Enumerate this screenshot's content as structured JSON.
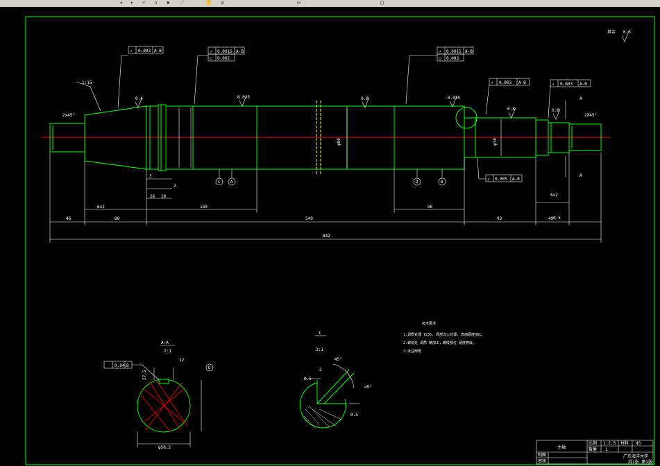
{
  "toolbar": {
    "icons": [
      "undo-icon",
      "redo-icon",
      "cut-icon",
      "copy-icon",
      "paste-icon",
      "match-properties-icon",
      "pan-icon",
      "zoom-icon",
      "zoom-window-icon",
      "zoom-previous-icon"
    ]
  },
  "drawing": {
    "colors": {
      "background": "#000000",
      "outline": "#00ff00",
      "centerline": "#ff0000",
      "dims": "#ffffff",
      "hatch": "#ff0000",
      "keyline": "#ffff00"
    },
    "roughness_label": "其余",
    "roughness_value": "6.3",
    "tol_frames": [
      {
        "sym": "↗",
        "val": "0.003",
        "ref": "A-B"
      },
      {
        "sym": "↗",
        "val": "0.0015",
        "ref": "A-B",
        "sym2": "◯",
        "val2": "0.002"
      },
      {
        "sym": "↗",
        "val": "0.0015",
        "ref": "A-B",
        "sym2": "◯",
        "val2": "0.003"
      },
      {
        "sym": "↗",
        "val": "0.003",
        "ref": "A-B"
      },
      {
        "sym": "↗",
        "val": "0.003",
        "ref": "A-B"
      },
      {
        "sym": "⊥",
        "val": "0.005",
        "ref": "A-B"
      }
    ],
    "surface_finish": [
      "0.4",
      "0.025",
      "0.8",
      "0.025",
      "0.8",
      "0.8"
    ],
    "taper_label": "1:15",
    "chamfers": [
      "2x45°",
      "2X45°"
    ],
    "datum_letters": [
      "C",
      "A",
      "D",
      "B",
      "A",
      "A"
    ],
    "dims": {
      "d46": "46",
      "d6x2": "6x2",
      "d80": "80",
      "d169": "169",
      "d549": "549",
      "d96": "96",
      "d93": "93",
      "d49": "49",
      "d842": "842",
      "d3": "3",
      "d2": "2",
      "d26": "26",
      "d10": "10",
      "d6x2b": "6x2",
      "d05": "0.5",
      "dia_fi80": "φ80",
      "dia_70": "φ70"
    },
    "section_aa_title": "A—A",
    "section_aa_scale": "2:1",
    "section_aa_tol": "0.04",
    "section_aa_ref": "B",
    "section_aa_width": "12",
    "section_aa_dia": "φ58.2",
    "section_aa_keyh": "27.5",
    "detail_title": "I",
    "detail_scale": "2:1",
    "detail_angle1": "45°",
    "detail_angle2": "45°",
    "detail_dim1": "0.5",
    "detail_dim2": "2",
    "detail_dim3": "0.5",
    "notes_title": "技术要求",
    "notes": [
      "1.调质处理 T235, 局部淬火处理, 表面硬度HRC。",
      "2.螺纹处 调质 精加工，螺纹部位 硬度等级。",
      "3.未注倒角"
    ],
    "title_block": {
      "part_name": "主轴",
      "scale_label": "比例",
      "scale_value": "1:2.5",
      "qty_label": "数量",
      "qty_value": "1",
      "material_label": "材料",
      "material_value": "45",
      "drawn": "制图",
      "checked": "审核",
      "school": "广东海洋大学",
      "sheet": "共1张 第1张"
    }
  }
}
